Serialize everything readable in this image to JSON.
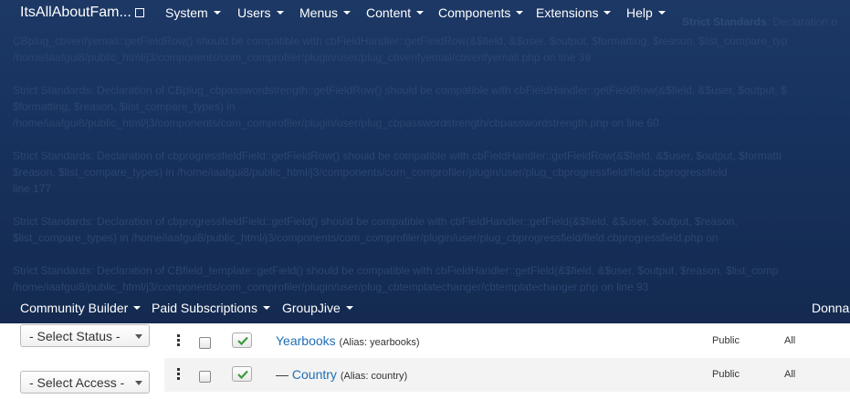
{
  "header": {
    "site_name": "ItsAllAboutFam...",
    "menus": [
      {
        "label": "System"
      },
      {
        "label": "Users"
      },
      {
        "label": "Menus"
      },
      {
        "label": "Content"
      },
      {
        "label": "Components"
      },
      {
        "label": "Extensions"
      },
      {
        "label": "Help"
      }
    ]
  },
  "errors": [
    {
      "t1": "Strict Standards",
      "t2": ": Declaration o",
      "style": "strong-only"
    },
    {
      "text": "CBplug_cbverifyemail::getFieldRow() should be compatible with cbFieldHandler::getFieldRow(&$field, &$user, $output, $formatting, $reason, $list_compare_typ"
    },
    {
      "text": "/home/iaafgui8/public_html/j3/components/com_comprofiler/plugin/user/plug_cbverifyemail/cbverifyemail.php on line 39"
    },
    {
      "text": "Strict Standards: Declaration of CBplug_cbpasswordstrength::getFieldRow() should be compatible with cbFieldHandler::getFieldRow(&$field, &$user, $output, $"
    },
    {
      "text": "$formatting, $reason, $list_compare_types) in"
    },
    {
      "text": "/home/iaafgui8/public_html/j3/components/com_comprofiler/plugin/user/plug_cbpasswordstrength/cbpasswordstrength.php on line 60"
    },
    {
      "text": "Strict Standards: Declaration of cbprogressfieldField::getFieldRow() should be compatible with cbFieldHandler::getFieldRow(&$field, &$user, $output, $formatti"
    },
    {
      "text": "$reason, $list_compare_types) in /home/iaafgui8/public_html/j3/components/com_comprofiler/plugin/user/plug_cbprogressfield/field.cbprogressfield"
    },
    {
      "text": "line 177"
    },
    {
      "text": "Strict Standards: Declaration of cbprogressfieldField::getField() should be compatible with cbFieldHandler::getField(&$field, &$user, $output, $reason,"
    },
    {
      "text": "$list_compare_types) in /home/iaafgui8/public_html/j3/components/com_comprofiler/plugin/user/plug_cbprogressfield/field.cbprogressfield.php on"
    },
    {
      "text": "Strict Standards: Declaration of CBfield_template::getField() should be compatible with cbFieldHandler::getField(&$field, &$user, $output, $reason, $list_comp"
    },
    {
      "text": "/home/iaafgui8/public_html/j3/components/com_comprofiler/plugin/user/plug_cbtemplatechanger/cbtemplatechanger.php on line 93"
    }
  ],
  "cb_menu": [
    {
      "label": "Community Builder"
    },
    {
      "label": "Paid Subscriptions"
    },
    {
      "label": "GroupJive"
    }
  ],
  "user_name": "Donna",
  "filters": {
    "status": "- Select Status -",
    "access": "- Select Access -"
  },
  "rows": [
    {
      "prefix": "",
      "title": "Yearbooks",
      "alias": "(Alias: yearbooks)",
      "access": "Public",
      "language": "All"
    },
    {
      "prefix": "— ",
      "title": "Country",
      "alias": "(Alias: country)",
      "access": "Public",
      "language": "All"
    }
  ],
  "colors": {
    "header_bg": "#17325e",
    "link": "#1f6eb5",
    "published_check": "#3c9a3c"
  }
}
